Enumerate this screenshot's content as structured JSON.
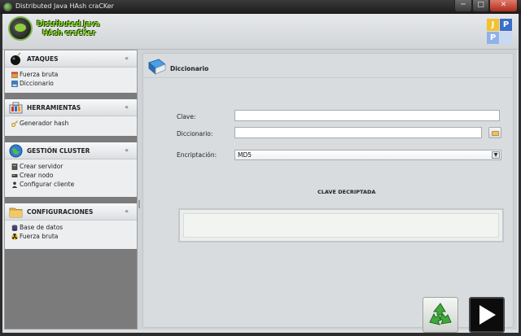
{
  "window": {
    "title": "Distributed Java HAsh craCKer",
    "min_symbol": "─",
    "max_symbol": "□",
    "close_symbol": "✕"
  },
  "header": {
    "logo_line1": "Distributed Java",
    "logo_line2": "HAsh craCKer",
    "badge_letters": [
      "J",
      "P",
      "P",
      ""
    ],
    "badge_colors": [
      "#f2c12e",
      "#3a6fc9",
      "#8fb2e8",
      "#c9d9f2"
    ]
  },
  "sidebar": {
    "sections": [
      {
        "title": "ATAQUES",
        "chevron": "«",
        "icon": "bomb-icon",
        "items": [
          {
            "label": "Fuerza bruta",
            "icon": "box-icon"
          },
          {
            "label": "Diccionario",
            "icon": "book-icon"
          }
        ]
      },
      {
        "title": "HERRAMIENTAS",
        "chevron": "«",
        "icon": "toolbox-icon",
        "items": [
          {
            "label": "Generador hash",
            "icon": "key-icon"
          }
        ]
      },
      {
        "title": "GESTIÓN CLUSTER",
        "chevron": "«",
        "icon": "globe-icon",
        "items": [
          {
            "label": "Crear servidor",
            "icon": "server-icon"
          },
          {
            "label": "Crear nodo",
            "icon": "node-icon"
          },
          {
            "label": "Configurar cliente",
            "icon": "user-icon"
          }
        ]
      },
      {
        "title": "CONFIGURACIONES",
        "chevron": "«",
        "icon": "folder-icon",
        "items": [
          {
            "label": "Base de datos",
            "icon": "database-icon"
          },
          {
            "label": "Fuerza bruta",
            "icon": "radiation-icon"
          }
        ]
      }
    ]
  },
  "panel": {
    "title": "Diccionario",
    "fields": {
      "clave_label": "Clave:",
      "clave_value": "",
      "diccionario_label": "Diccionario:",
      "diccionario_value": "",
      "encriptacion_label": "Encriptación:",
      "encriptacion_value": "MD5"
    },
    "result_title": "CLAVE DECRIPTADA",
    "result_value": "",
    "reset_icon": "recycle-icon",
    "run_icon": "play-icon"
  }
}
